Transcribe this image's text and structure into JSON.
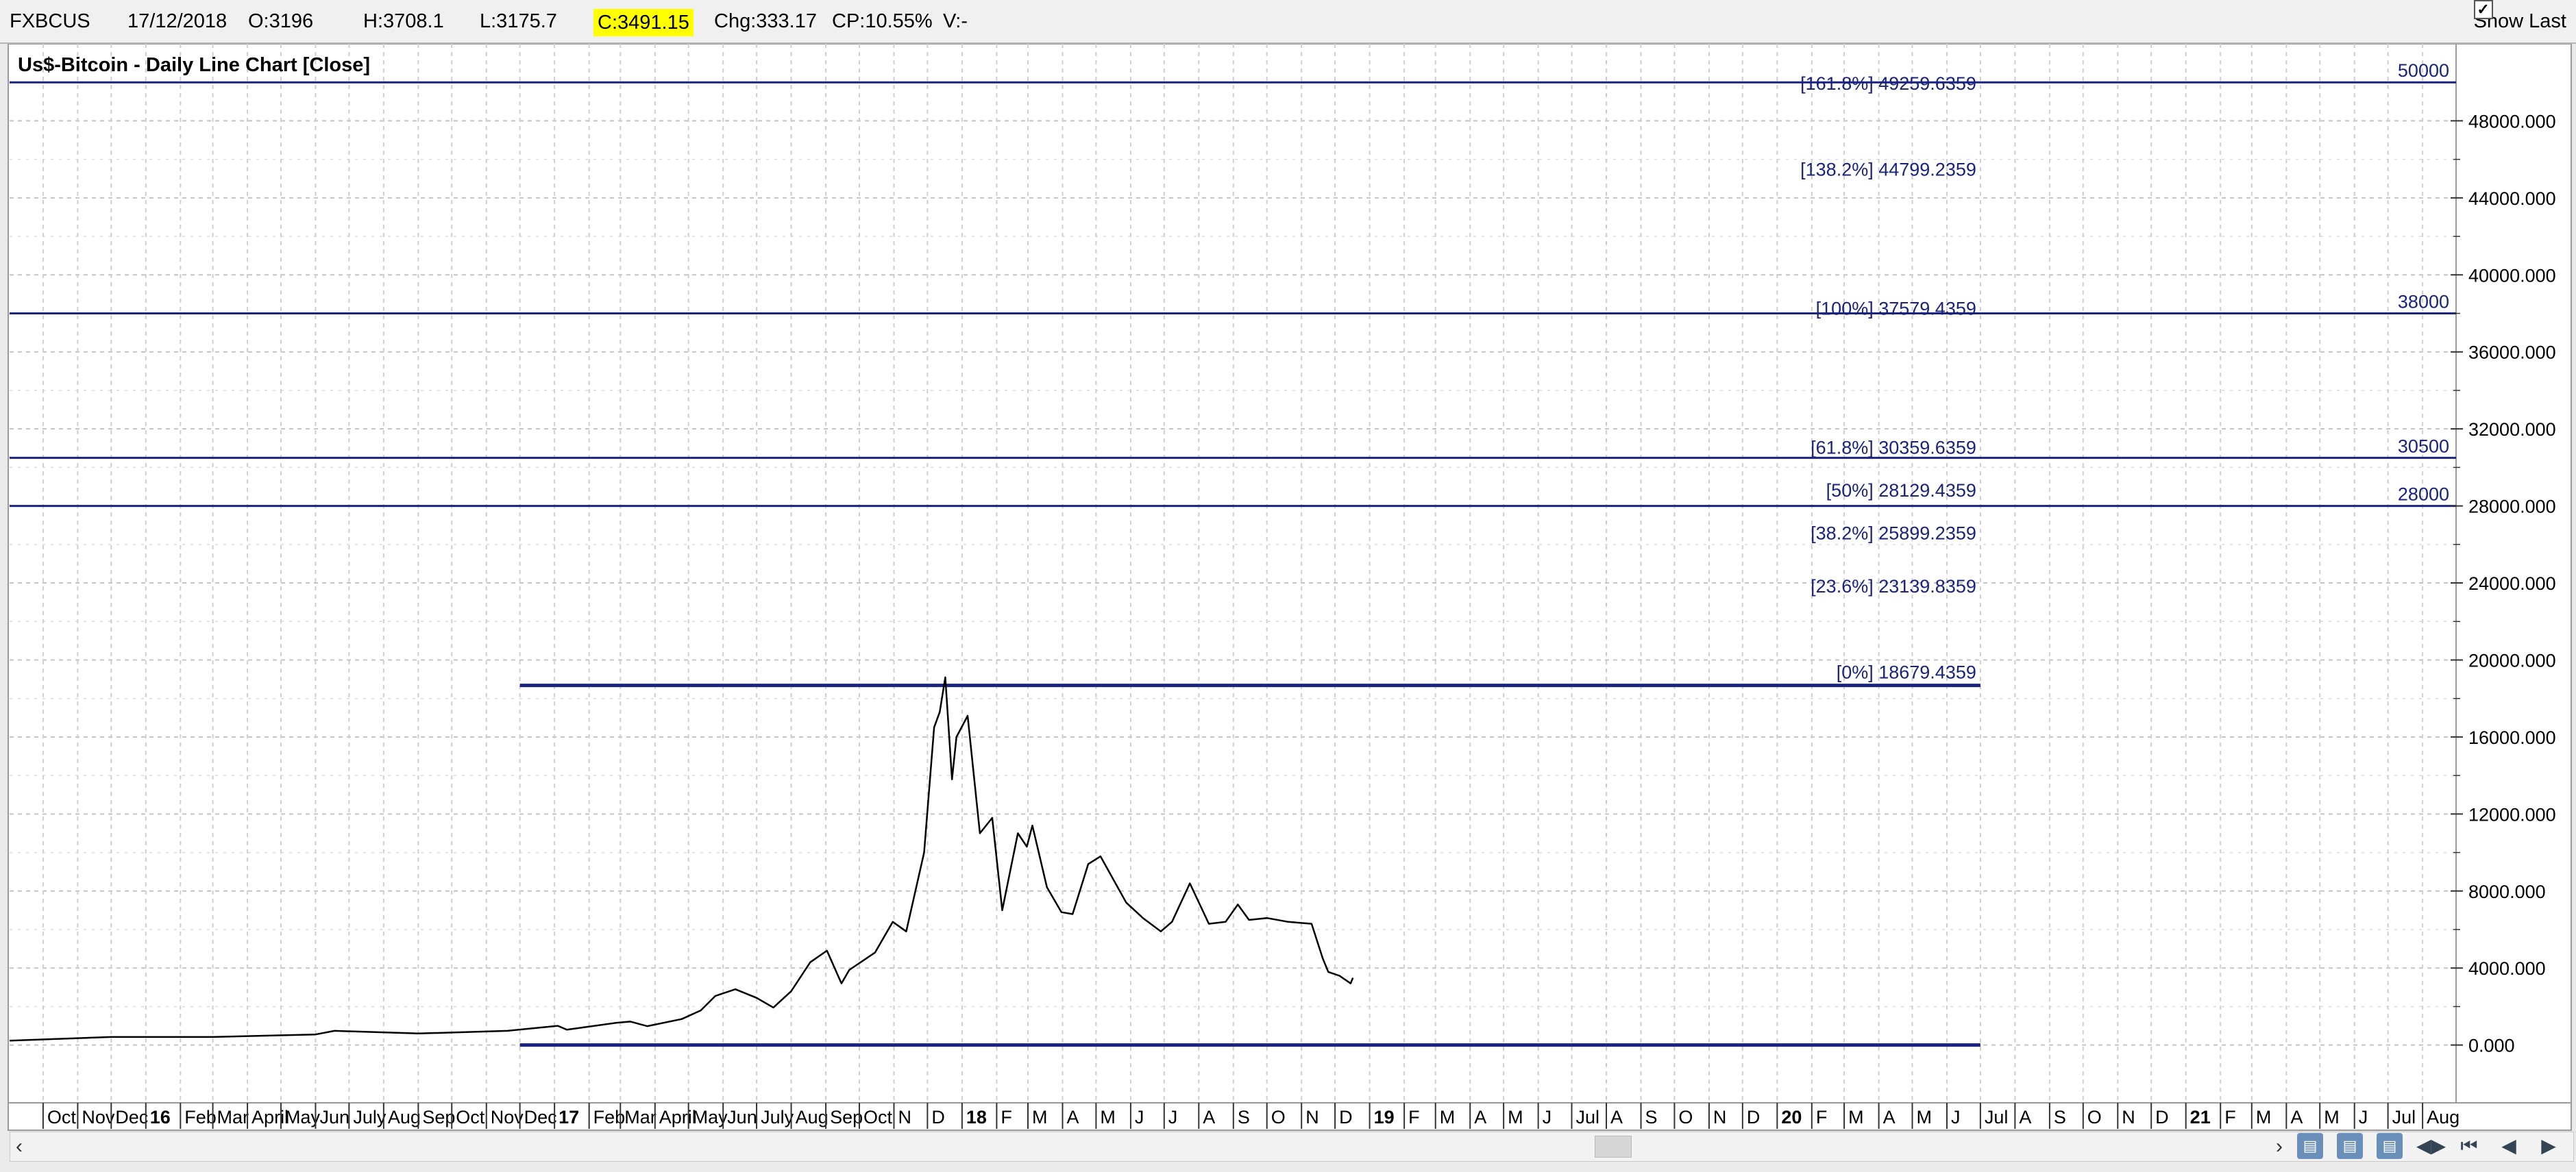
{
  "infobar": {
    "symbol": "FXBCUS",
    "date": "17/12/2018",
    "open": "O:3196",
    "high": "H:3708.1",
    "low": "L:3175.7",
    "close": "C:3491.15",
    "change": "Chg:333.17",
    "change_pct": "CP:10.55%",
    "volume": "V:-",
    "show_last_label": "Show Last",
    "show_last_checked": true
  },
  "chart_data": {
    "type": "line",
    "title": "Us$-Bitcoin - Daily Line Chart [Close]",
    "xlabel": "",
    "ylabel": "",
    "ylim": [
      -3000,
      52000
    ],
    "xlim": [
      "2015-09-01",
      "2021-08-31"
    ],
    "grid": true,
    "y_ticks": [
      0,
      4000,
      8000,
      12000,
      16000,
      20000,
      24000,
      28000,
      32000,
      36000,
      40000,
      44000,
      48000
    ],
    "y_tick_labels": [
      "0.000",
      "4000.000",
      "8000.000",
      "12000.000",
      "16000.000",
      "20000.000",
      "24000.000",
      "28000.000",
      "32000.000",
      "36000.000",
      "40000.000",
      "44000.000",
      "48000.000"
    ],
    "x_ticks": [
      {
        "d": "2015-10-01",
        "label": "Oct",
        "bold": false
      },
      {
        "d": "2015-11-01",
        "label": "Nov",
        "bold": false
      },
      {
        "d": "2015-12-01",
        "label": "Dec",
        "bold": false
      },
      {
        "d": "2016-01-01",
        "label": "16",
        "bold": true
      },
      {
        "d": "2016-02-01",
        "label": "Feb",
        "bold": false
      },
      {
        "d": "2016-03-01",
        "label": "Mar",
        "bold": false
      },
      {
        "d": "2016-04-01",
        "label": "April",
        "bold": false
      },
      {
        "d": "2016-05-01",
        "label": "May",
        "bold": false
      },
      {
        "d": "2016-06-01",
        "label": "Jun",
        "bold": false
      },
      {
        "d": "2016-07-01",
        "label": "July",
        "bold": false
      },
      {
        "d": "2016-08-01",
        "label": "Aug",
        "bold": false
      },
      {
        "d": "2016-09-01",
        "label": "Sep",
        "bold": false
      },
      {
        "d": "2016-10-01",
        "label": "Oct",
        "bold": false
      },
      {
        "d": "2016-11-01",
        "label": "Nov",
        "bold": false
      },
      {
        "d": "2016-12-01",
        "label": "Dec",
        "bold": false
      },
      {
        "d": "2017-01-01",
        "label": "17",
        "bold": true
      },
      {
        "d": "2017-02-01",
        "label": "Feb",
        "bold": false
      },
      {
        "d": "2017-03-01",
        "label": "Mar",
        "bold": false
      },
      {
        "d": "2017-04-01",
        "label": "April",
        "bold": false
      },
      {
        "d": "2017-05-01",
        "label": "May",
        "bold": false
      },
      {
        "d": "2017-06-01",
        "label": "Jun",
        "bold": false
      },
      {
        "d": "2017-07-01",
        "label": "July",
        "bold": false
      },
      {
        "d": "2017-08-01",
        "label": "Aug",
        "bold": false
      },
      {
        "d": "2017-09-01",
        "label": "Sep",
        "bold": false
      },
      {
        "d": "2017-10-01",
        "label": "Oct",
        "bold": false
      },
      {
        "d": "2017-11-01",
        "label": "N",
        "bold": false
      },
      {
        "d": "2017-12-01",
        "label": "D",
        "bold": false
      },
      {
        "d": "2018-01-01",
        "label": "18",
        "bold": true
      },
      {
        "d": "2018-02-01",
        "label": "F",
        "bold": false
      },
      {
        "d": "2018-03-01",
        "label": "M",
        "bold": false
      },
      {
        "d": "2018-04-01",
        "label": "A",
        "bold": false
      },
      {
        "d": "2018-05-01",
        "label": "M",
        "bold": false
      },
      {
        "d": "2018-06-01",
        "label": "J",
        "bold": false
      },
      {
        "d": "2018-07-01",
        "label": "J",
        "bold": false
      },
      {
        "d": "2018-08-01",
        "label": "A",
        "bold": false
      },
      {
        "d": "2018-09-01",
        "label": "S",
        "bold": false
      },
      {
        "d": "2018-10-01",
        "label": "O",
        "bold": false
      },
      {
        "d": "2018-11-01",
        "label": "N",
        "bold": false
      },
      {
        "d": "2018-12-01",
        "label": "D",
        "bold": false
      },
      {
        "d": "2019-01-01",
        "label": "19",
        "bold": true
      },
      {
        "d": "2019-02-01",
        "label": "F",
        "bold": false
      },
      {
        "d": "2019-03-01",
        "label": "M",
        "bold": false
      },
      {
        "d": "2019-04-01",
        "label": "A",
        "bold": false
      },
      {
        "d": "2019-05-01",
        "label": "M",
        "bold": false
      },
      {
        "d": "2019-06-01",
        "label": "J",
        "bold": false
      },
      {
        "d": "2019-07-01",
        "label": "Jul",
        "bold": false
      },
      {
        "d": "2019-08-01",
        "label": "A",
        "bold": false
      },
      {
        "d": "2019-09-01",
        "label": "S",
        "bold": false
      },
      {
        "d": "2019-10-01",
        "label": "O",
        "bold": false
      },
      {
        "d": "2019-11-01",
        "label": "N",
        "bold": false
      },
      {
        "d": "2019-12-01",
        "label": "D",
        "bold": false
      },
      {
        "d": "2020-01-01",
        "label": "20",
        "bold": true
      },
      {
        "d": "2020-02-01",
        "label": "F",
        "bold": false
      },
      {
        "d": "2020-03-01",
        "label": "M",
        "bold": false
      },
      {
        "d": "2020-04-01",
        "label": "A",
        "bold": false
      },
      {
        "d": "2020-05-01",
        "label": "M",
        "bold": false
      },
      {
        "d": "2020-06-01",
        "label": "J",
        "bold": false
      },
      {
        "d": "2020-07-01",
        "label": "Jul",
        "bold": false
      },
      {
        "d": "2020-08-01",
        "label": "A",
        "bold": false
      },
      {
        "d": "2020-09-01",
        "label": "S",
        "bold": false
      },
      {
        "d": "2020-10-01",
        "label": "O",
        "bold": false
      },
      {
        "d": "2020-11-01",
        "label": "N",
        "bold": false
      },
      {
        "d": "2020-12-01",
        "label": "D",
        "bold": false
      },
      {
        "d": "2021-01-01",
        "label": "21",
        "bold": true
      },
      {
        "d": "2021-02-01",
        "label": "F",
        "bold": false
      },
      {
        "d": "2021-03-01",
        "label": "M",
        "bold": false
      },
      {
        "d": "2021-04-01",
        "label": "A",
        "bold": false
      },
      {
        "d": "2021-05-01",
        "label": "M",
        "bold": false
      },
      {
        "d": "2021-06-01",
        "label": "J",
        "bold": false
      },
      {
        "d": "2021-07-01",
        "label": "Jul",
        "bold": false
      },
      {
        "d": "2021-08-01",
        "label": "Aug",
        "bold": false
      }
    ],
    "series": [
      {
        "color": "#000000",
        "x": [
          "2015-09-01",
          "2015-12-01",
          "2016-03-01",
          "2016-06-01",
          "2016-06-18",
          "2016-09-01",
          "2016-11-20",
          "2017-01-04",
          "2017-01-12",
          "2017-02-25",
          "2017-03-10",
          "2017-03-25",
          "2017-04-25",
          "2017-05-12",
          "2017-05-25",
          "2017-06-12",
          "2017-07-01",
          "2017-07-16",
          "2017-08-01",
          "2017-08-18",
          "2017-09-02",
          "2017-09-15",
          "2017-09-22",
          "2017-10-15",
          "2017-10-31",
          "2017-11-12",
          "2017-11-28",
          "2017-12-07",
          "2017-12-12",
          "2017-12-17",
          "2017-12-23",
          "2017-12-27",
          "2018-01-06",
          "2018-01-17",
          "2018-01-28",
          "2018-02-06",
          "2018-02-20",
          "2018-02-28",
          "2018-03-05",
          "2018-03-18",
          "2018-03-31",
          "2018-04-10",
          "2018-04-24",
          "2018-05-05",
          "2018-05-28",
          "2018-06-12",
          "2018-06-28",
          "2018-07-08",
          "2018-07-24",
          "2018-08-10",
          "2018-08-25",
          "2018-09-05",
          "2018-09-15",
          "2018-10-01",
          "2018-10-20",
          "2018-11-10",
          "2018-11-20",
          "2018-11-25",
          "2018-12-05",
          "2018-12-15",
          "2018-12-17"
        ],
        "values": [
          230,
          420,
          420,
          550,
          740,
          600,
          740,
          1000,
          800,
          1150,
          1220,
          980,
          1350,
          1800,
          2550,
          2900,
          2450,
          1950,
          2800,
          4300,
          4900,
          3200,
          3900,
          4800,
          6400,
          5900,
          10000,
          16500,
          17300,
          19100,
          13800,
          16000,
          17100,
          11000,
          11800,
          7000,
          11000,
          10300,
          11400,
          8200,
          6900,
          6800,
          9400,
          9800,
          7400,
          6600,
          5900,
          6400,
          8400,
          6300,
          6400,
          7300,
          6500,
          6600,
          6400,
          6300,
          4500,
          3800,
          3600,
          3200,
          3491
        ]
      }
    ],
    "horizontal_levels": [
      {
        "value": 49259.6359,
        "label": "[161.8%] 49259.6359",
        "full_width": false
      },
      {
        "value": 44799.2359,
        "label": "[138.2%] 44799.2359",
        "full_width": false
      },
      {
        "value": 37579.4359,
        "label": "[100%] 37579.4359",
        "full_width": false
      },
      {
        "value": 30359.6359,
        "label": "[61.8%] 30359.6359",
        "full_width": false
      },
      {
        "value": 28129.4359,
        "label": "[50%] 28129.4359",
        "full_width": false
      },
      {
        "value": 25899.2359,
        "label": "[38.2%] 25899.2359",
        "full_width": false
      },
      {
        "value": 23139.8359,
        "label": "[23.6%] 23139.8359",
        "full_width": false
      },
      {
        "value": 18679.4359,
        "label": "[0%] 18679.4359",
        "full_width": false,
        "line": true,
        "from": "2016-12-01",
        "to": "2020-07-01"
      },
      {
        "value": 0,
        "label": "",
        "line": true,
        "from": "2016-12-01",
        "to": "2020-07-01"
      }
    ],
    "full_lines": [
      {
        "value": 50000,
        "label": "50000"
      },
      {
        "value": 38000,
        "label": "38000"
      },
      {
        "value": 30500,
        "label": "30500"
      },
      {
        "value": 28000,
        "label": "28000"
      }
    ],
    "line_color": "#1a237e"
  }
}
